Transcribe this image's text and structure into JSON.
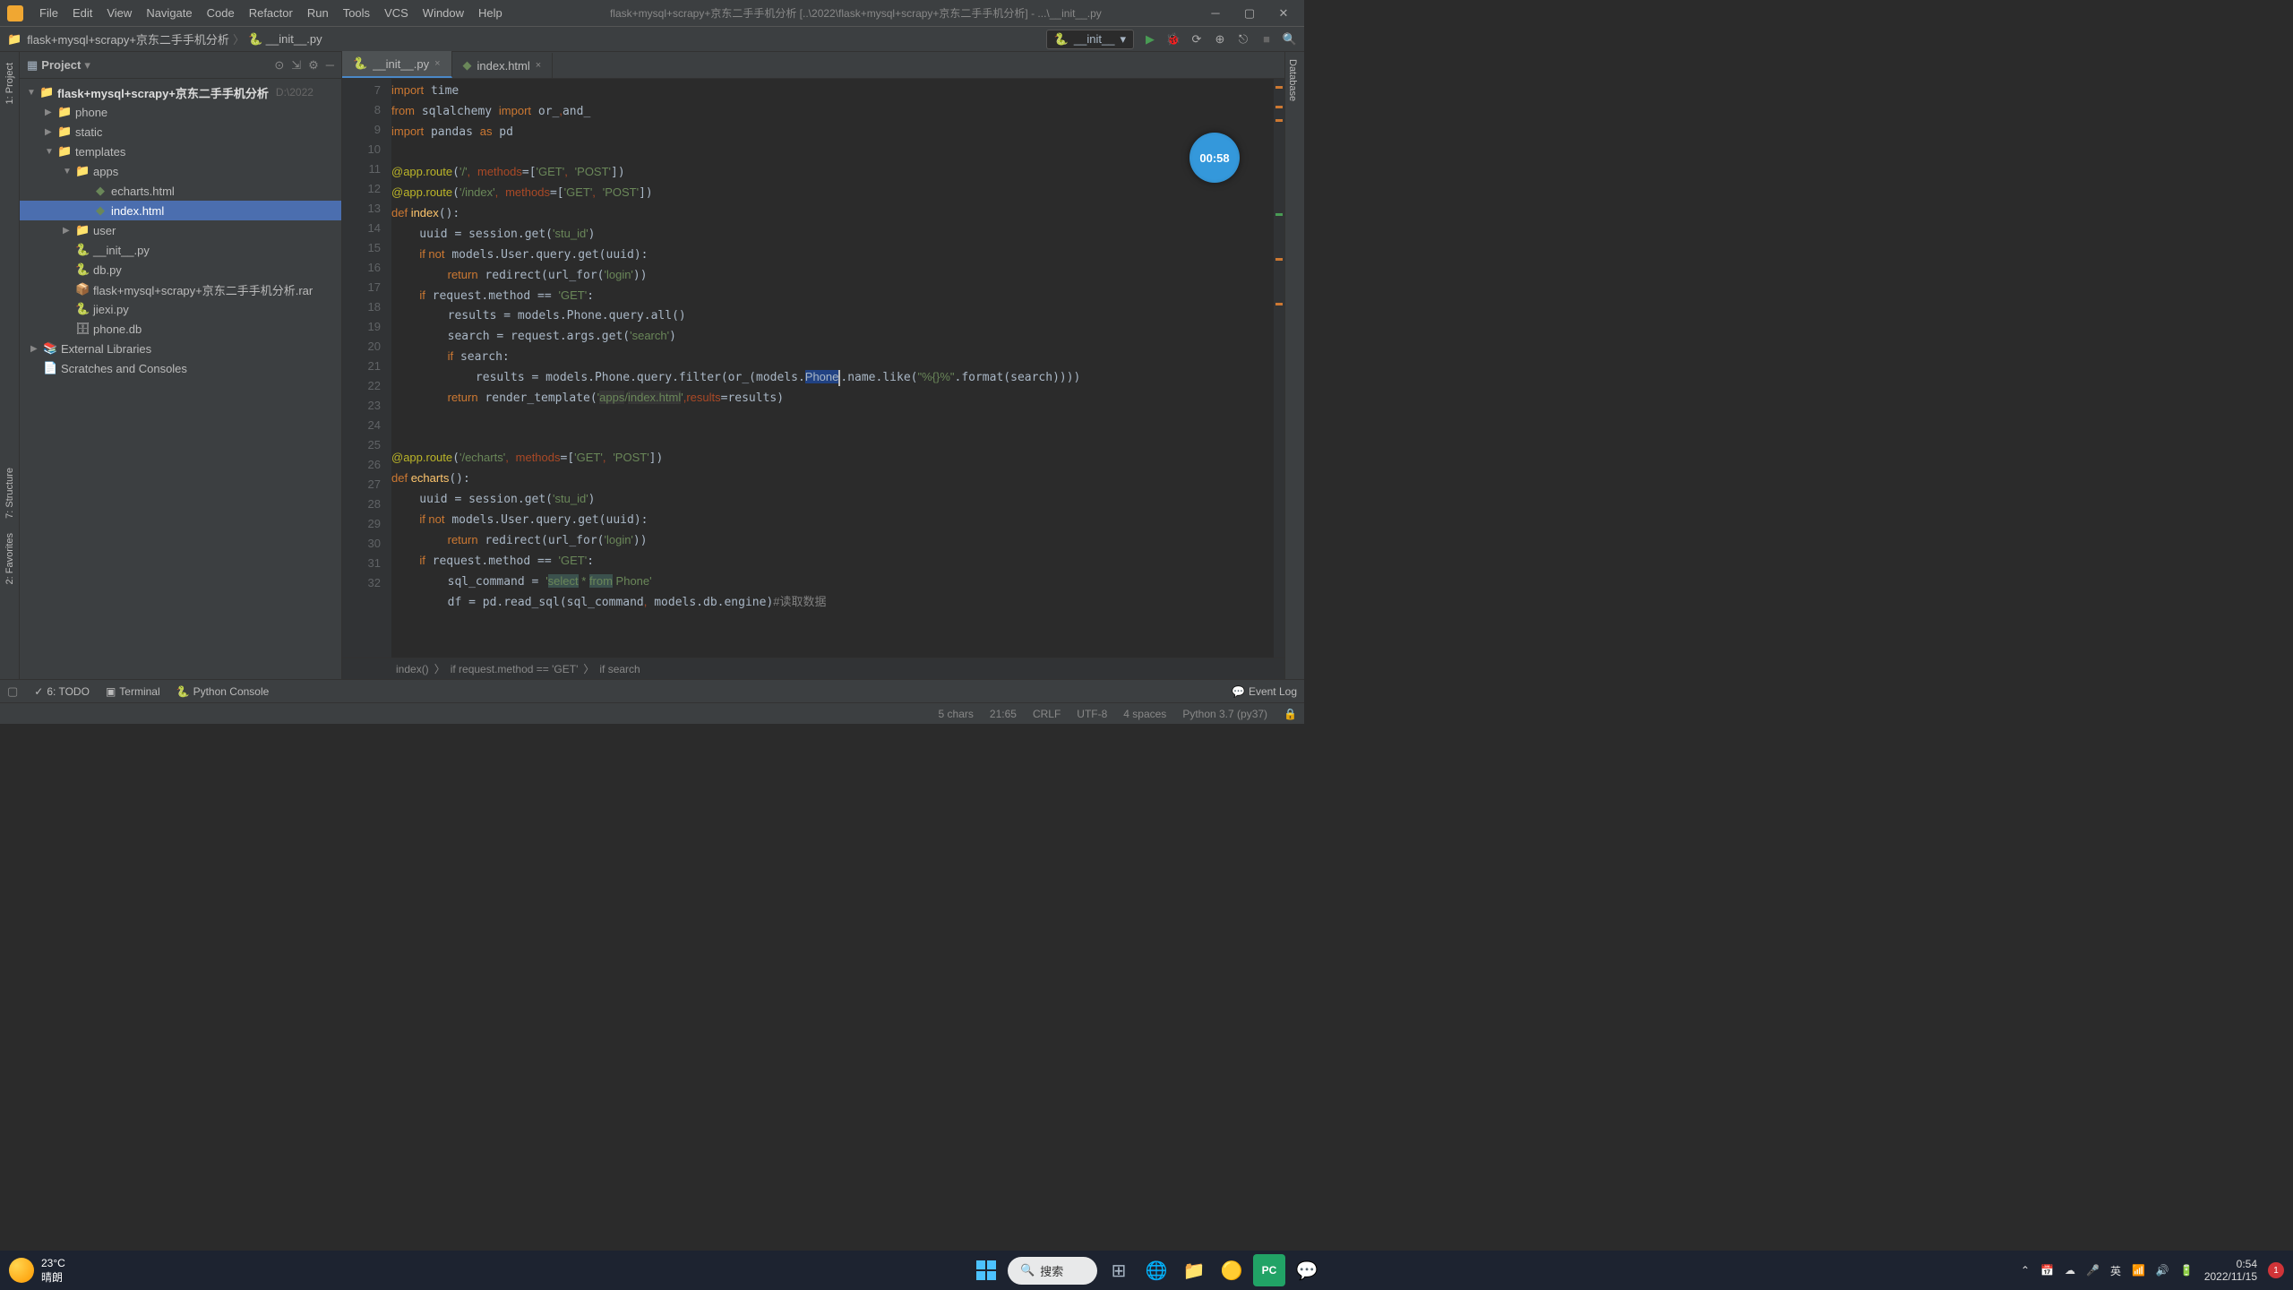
{
  "menus": [
    "File",
    "Edit",
    "View",
    "Navigate",
    "Code",
    "Refactor",
    "Run",
    "Tools",
    "VCS",
    "Window",
    "Help"
  ],
  "windowTitle": "flask+mysql+scrapy+京东二手手机分析 [..\\2022\\flask+mysql+scrapy+京东二手手机分析] - ...\\__init__.py",
  "nav": {
    "project": "flask+mysql+scrapy+京东二手手机分析",
    "file": "__init__.py"
  },
  "runConfig": "__init__",
  "panel": {
    "title": "Project"
  },
  "tree": {
    "root": "flask+mysql+scrapy+京东二手手机分析",
    "rootPath": "D:\\2022",
    "phone": "phone",
    "static": "static",
    "templates": "templates",
    "apps": "apps",
    "echarts": "echarts.html",
    "index": "index.html",
    "user": "user",
    "init": "__init__.py",
    "db": "db.py",
    "rar": "flask+mysql+scrapy+京东二手手机分析.rar",
    "jiexi": "jiexi.py",
    "phonedb": "phone.db",
    "extlib": "External Libraries",
    "scratches": "Scratches and Consoles"
  },
  "tabs": {
    "init": "__init__.py",
    "index": "index.html"
  },
  "gutter": [
    "7",
    "8",
    "9",
    "10",
    "11",
    "12",
    "13",
    "14",
    "15",
    "16",
    "17",
    "18",
    "19",
    "20",
    "21",
    "22",
    "23",
    "24",
    "25",
    "26",
    "27",
    "28",
    "29",
    "30",
    "31",
    "32"
  ],
  "timer": "00:58",
  "breadcrumb": [
    "index()",
    "if request.method == 'GET'",
    "if search"
  ],
  "bottomTabs": {
    "todo": "6: TODO",
    "terminal": "Terminal",
    "console": "Python Console",
    "eventLog": "Event Log"
  },
  "status": {
    "chars": "5 chars",
    "pos": "21:65",
    "encoding": "CRLF",
    "charset": "UTF-8",
    "indent": "4 spaces",
    "python": "Python 3.7 (py37)"
  },
  "weather": {
    "temp": "23°C",
    "cond": "晴朗"
  },
  "search": "搜索",
  "ime": "英",
  "clock": {
    "time": "0:54",
    "date": "2022/11/15"
  },
  "notif": "1",
  "leftTabs": {
    "project": "1: Project",
    "structure": "7: Structure",
    "favorites": "2: Favorites"
  },
  "rightTabs": {
    "database": "Database"
  }
}
